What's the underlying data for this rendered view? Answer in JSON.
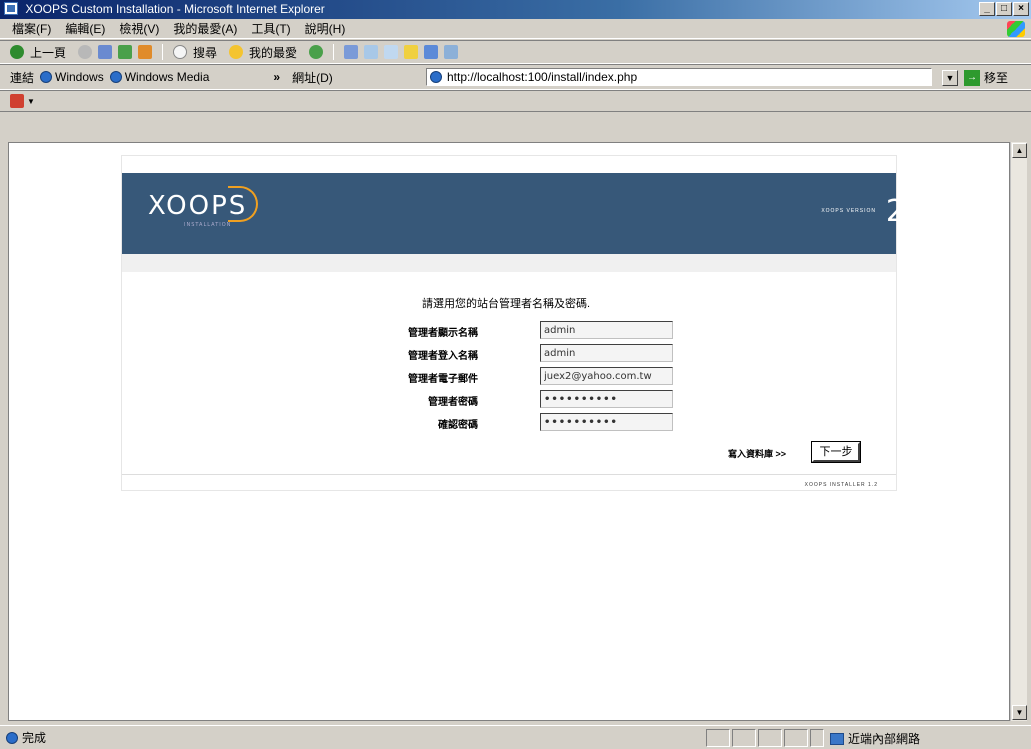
{
  "window": {
    "title": "XOOPS Custom Installation - Microsoft Internet Explorer"
  },
  "menu": [
    "檔案(F)",
    "編輯(E)",
    "檢視(V)",
    "我的最愛(A)",
    "工具(T)",
    "說明(H)"
  ],
  "toolbar": {
    "back": "上一頁",
    "search": "搜尋",
    "favorites": "我的最愛"
  },
  "links_bar": {
    "label": "連結",
    "link1": "Windows",
    "link2": "Windows Media",
    "chevron": "»"
  },
  "address": {
    "label": "網址(D)",
    "url": "http://localhost:100/install/index.php",
    "go": "移至"
  },
  "page": {
    "logo": "XOOPS",
    "logo_sub": "INSTALLATION",
    "version_label": "XOOPS VERSION",
    "version_num": "2",
    "prompt": "請選用您的站台管理者名稱及密碼.",
    "fields": [
      {
        "label": "管理者顯示名稱",
        "value": "admin"
      },
      {
        "label": "管理者登入名稱",
        "value": "admin"
      },
      {
        "label": "管理者電子郵件",
        "value": "juex2@yahoo.com.tw"
      },
      {
        "label": "管理者密碼",
        "value": "••••••••••"
      },
      {
        "label": "確認密碼",
        "value": "••••••••••"
      }
    ],
    "next_prefix": "寫入資料庫 >>",
    "next_button": "下一步",
    "footer": "XOOPS INSTALLER 1.2"
  },
  "status": {
    "text": "完成",
    "zone": "近端內部網路"
  }
}
